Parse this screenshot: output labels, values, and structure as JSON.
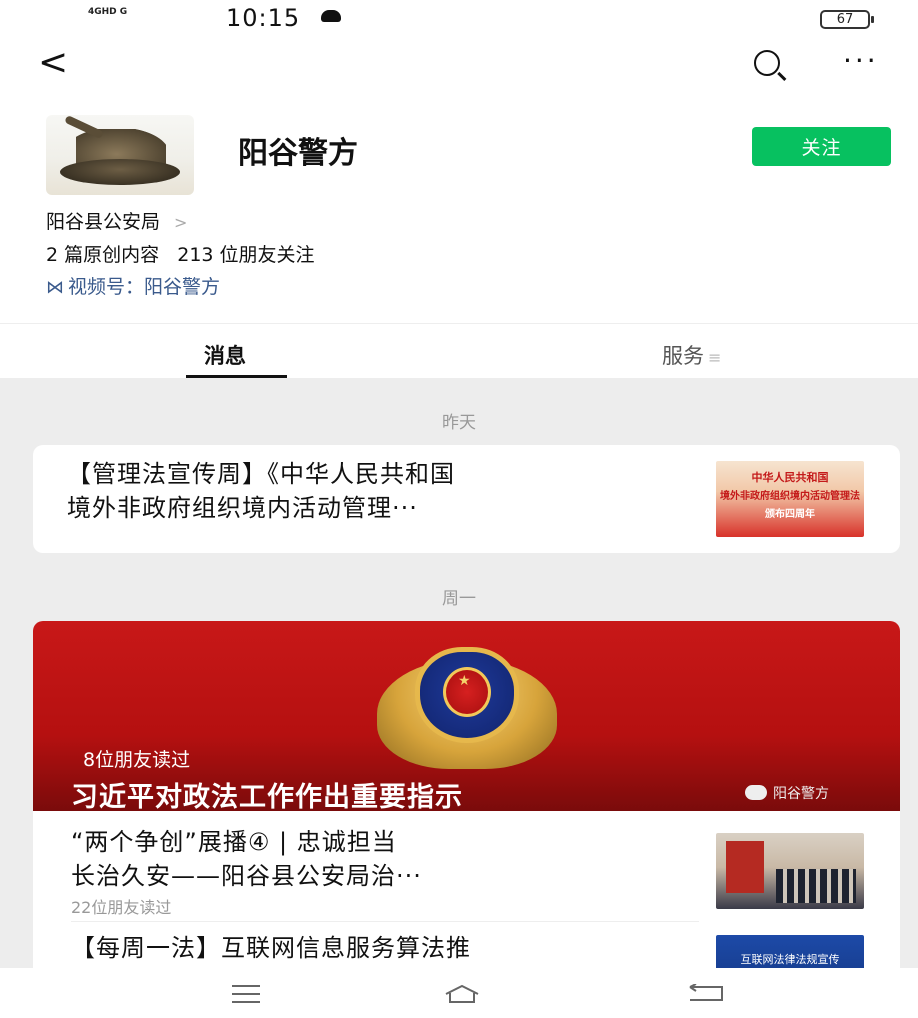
{
  "status_bar": {
    "network": "4GHD G",
    "time": "10:15",
    "battery": "67"
  },
  "nav": {
    "back_icon": "chevron-left-icon",
    "search_icon": "search-icon",
    "more_icon": "more-dots-icon",
    "more_glyph": "···"
  },
  "profile": {
    "name": "阳谷警方",
    "follow_label": "关注",
    "follow_color": "#07c160",
    "org": "阳谷县公安局",
    "org_chevron": ">",
    "stats": "2 篇原创内容   213 位朋友关注",
    "channel_label": "视频号：阳谷警方"
  },
  "tabs": [
    {
      "label": "消息",
      "active": true
    },
    {
      "label": "服务",
      "active": false
    }
  ],
  "feed": {
    "groups": [
      {
        "date": "昨天",
        "articles": [
          {
            "title_line1": "【管理法宣传周】《中华人民共和国",
            "title_line2": "境外非政府组织境内活动管理···"
          }
        ]
      },
      {
        "date": "周一",
        "banner": {
          "reads": "8位朋友读过",
          "title": "习近平对政法工作作出重要指示",
          "source": "阳谷警方"
        },
        "articles": [
          {
            "title_line1": "“两个争创”展播④ | 忠诚担当",
            "title_line2": "长治久安——阳谷县公安局治···",
            "reads": "22位朋友读过"
          },
          {
            "title_line1": "【每周一法】互联网信息服务算法推"
          }
        ]
      }
    ]
  },
  "thumbs": {
    "t1_text_top": "中华人民共和国",
    "t1_text_mid": "境外非政府组织境内活动管理法",
    "t1_text_bot": "颁布四周年",
    "t3_text": "互联网法律法规宣传"
  }
}
